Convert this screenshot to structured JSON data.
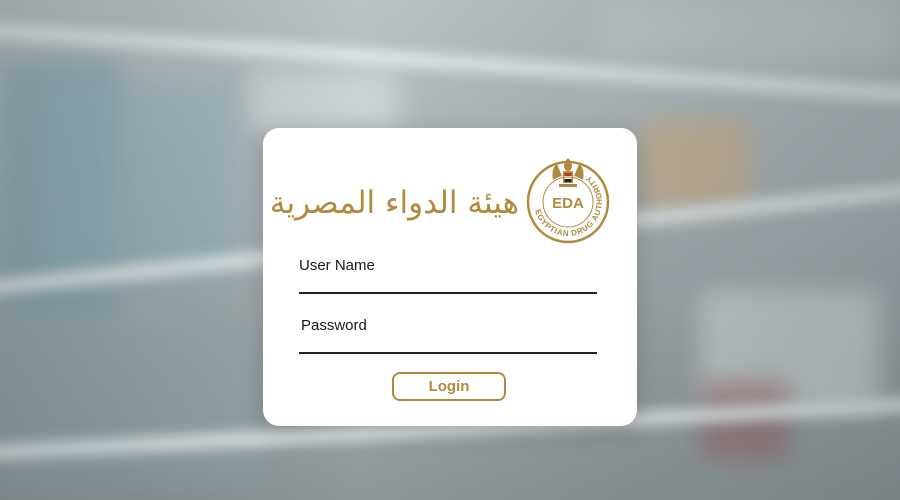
{
  "branding": {
    "arabic_name": "هيئة الدواء المصرية",
    "seal_monogram": "EDA",
    "seal_ring_text": "EGYPTIAN DRUG AUTHORITY",
    "accent_color": "#b08a3e"
  },
  "login_form": {
    "username_label": "User Name",
    "username_value": "",
    "password_label": "Password",
    "password_value": "",
    "login_label": "Login"
  }
}
